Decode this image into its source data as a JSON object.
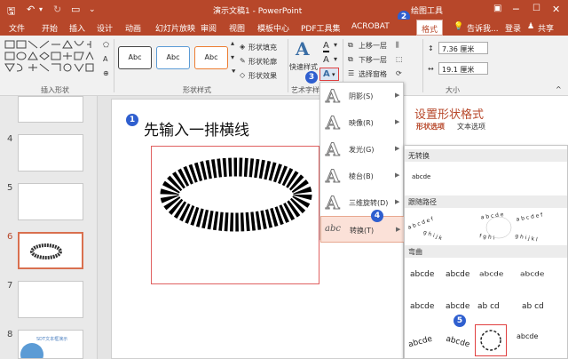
{
  "window": {
    "title": "演示文稿1 - PowerPoint",
    "drawing_tools_label": "绘图工具"
  },
  "tabs": [
    "文件",
    "开始",
    "插入",
    "设计",
    "动画",
    "幻灯片放映",
    "审阅",
    "视图",
    "模板中心",
    "PDF工具集",
    "ACROBAT",
    "格式"
  ],
  "tell_me": "告诉我...",
  "login": "登录",
  "share": "共享",
  "ribbon": {
    "insert_shapes_group": "插入形状",
    "shape_styles_group": "形状样式",
    "style_swatches": [
      "Abc",
      "Abc",
      "Abc"
    ],
    "shape_fill": "形状填充",
    "shape_outline": "形状轮廓",
    "shape_effects": "形状效果",
    "quick_styles": "快速样式",
    "wordart_group": "艺术字样",
    "bring_forward": "上移一层",
    "send_backward": "下移一层",
    "selection_pane": "选择窗格",
    "height_value": "7.36 厘米",
    "width_value": "19.1 厘米",
    "size_group": "大小"
  },
  "slides": [
    "4",
    "5",
    "6",
    "7",
    "8"
  ],
  "slide8_text": "SDT文本框演示",
  "slide_title": "先输入一排横线",
  "effects_menu": [
    {
      "label": "阴影(S)",
      "arrow": "▶"
    },
    {
      "label": "映像(R)",
      "arrow": "▶"
    },
    {
      "label": "发光(G)",
      "arrow": "▶"
    },
    {
      "label": "棱台(B)",
      "arrow": "▶"
    },
    {
      "label": "三维旋转(D)",
      "arrow": "▶"
    },
    {
      "label": "转换(T)",
      "arrow": "▶"
    }
  ],
  "format_pane": {
    "title": "设置形状格式",
    "tab_shape": "形状选项",
    "tab_text": "文本选项"
  },
  "warp_gallery": {
    "no_transform": "无转换",
    "no_transform_sample": "abcde",
    "follow_path": "跟随路径",
    "warp": "弯曲",
    "warp_samples": [
      "abcde",
      "abcde",
      "abcde",
      "abcde",
      "abcde",
      "abcde",
      "abcde",
      "abcde"
    ]
  },
  "badges": [
    "1",
    "2",
    "3",
    "4",
    "5"
  ],
  "colors": {
    "accent": "#b7472a",
    "badge": "#2f5fcf",
    "highlight": "#fbe1d8"
  }
}
